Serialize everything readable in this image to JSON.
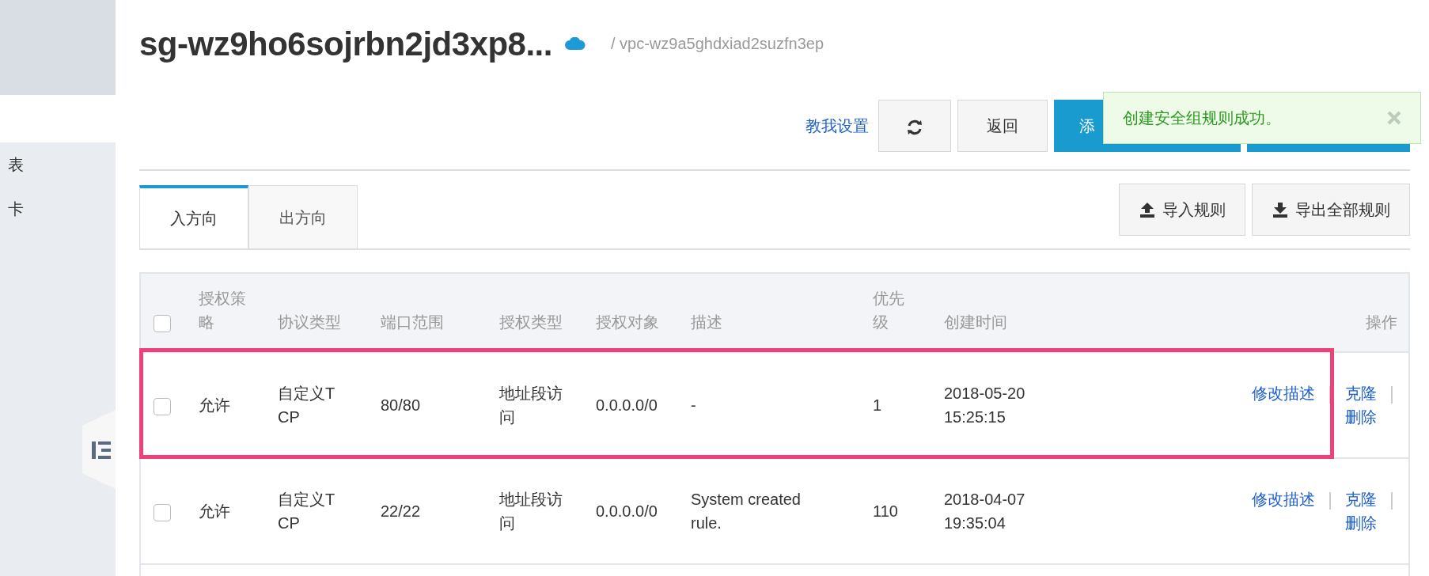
{
  "sidebar": {
    "items": [
      {
        "label": "表"
      },
      {
        "label": "卡"
      }
    ]
  },
  "header": {
    "title": "sg-wz9ho6sojrbn2jd3xp8...",
    "breadcrumb": "/ vpc-wz9a5ghdxiad2suzfn3ep"
  },
  "toolbar": {
    "help_link": "教我设置",
    "buttons": [
      {
        "kind": "refresh"
      },
      {
        "kind": "text",
        "label": "返回"
      },
      {
        "kind": "primary",
        "label": "添"
      },
      {
        "kind": "primary"
      }
    ]
  },
  "toast": {
    "message": "创建安全组规则成功。"
  },
  "tabs": [
    {
      "label": "入方向",
      "selected": true
    },
    {
      "label": "出方向",
      "selected": false
    }
  ],
  "rule_actions": [
    {
      "kind": "upload",
      "label": "导入规则"
    },
    {
      "kind": "download",
      "label": "导出全部规则"
    }
  ],
  "table": {
    "select_all_checked": false,
    "columns": [
      "授权策略",
      "协议类型",
      "端口范围",
      "授权类型",
      "授权对象",
      "描述",
      "优先级",
      "创建时间",
      "操作"
    ],
    "rows": [
      {
        "checked": false,
        "highlighted": true,
        "cells": [
          "允许",
          "自定义TCP",
          "80/80",
          "地址段访问",
          "0.0.0.0/0",
          "-",
          "1",
          "2018-05-20 15:25:15"
        ],
        "actions": [
          "修改描述",
          "克隆",
          "删除"
        ]
      },
      {
        "checked": false,
        "highlighted": false,
        "cells": [
          "允许",
          "自定义TCP",
          "22/22",
          "地址段访问",
          "0.0.0.0/0",
          "System created rule.",
          "110",
          "2018-04-07 19:35:04"
        ],
        "actions": [
          "修改描述",
          "克隆",
          "删除"
        ]
      }
    ]
  }
}
